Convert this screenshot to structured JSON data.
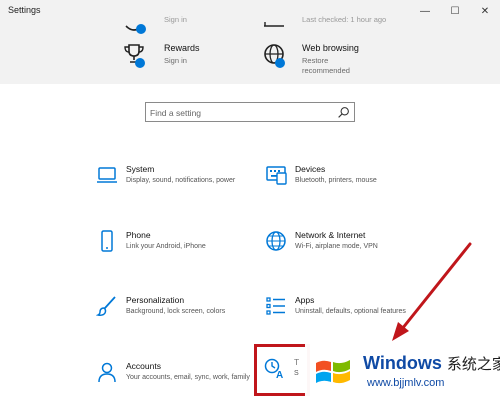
{
  "window": {
    "title": "Settings",
    "minimize": "—",
    "maximize": "☐",
    "close": "✕"
  },
  "banner": {
    "top_left_sub": "Sign in",
    "top_right_sub": "Last checked: 1 hour ago",
    "rewards": {
      "title": "Rewards",
      "sub": "Sign in"
    },
    "web_browsing": {
      "title": "Web browsing",
      "sub_line1": "Restore",
      "sub_line2": "recommended"
    }
  },
  "search": {
    "placeholder": "Find a setting"
  },
  "categories": [
    {
      "title": "System",
      "desc": "Display, sound, notifications, power",
      "icon": "laptop-icon"
    },
    {
      "title": "Devices",
      "desc": "Bluetooth, printers, mouse",
      "icon": "keyboard-icon"
    },
    {
      "title": "Phone",
      "desc": "Link your Android, iPhone",
      "icon": "phone-icon"
    },
    {
      "title": "Network & Internet",
      "desc": "Wi-Fi, airplane mode, VPN",
      "icon": "globe-icon"
    },
    {
      "title": "Personalization",
      "desc": "Background, lock screen, colors",
      "icon": "brush-icon"
    },
    {
      "title": "Apps",
      "desc": "Uninstall, defaults, optional features",
      "icon": "apps-list-icon"
    },
    {
      "title": "Accounts",
      "desc": "Your accounts, email, sync, work, family",
      "icon": "person-icon"
    },
    {
      "title": "T",
      "desc": "S",
      "icon": "time-language-icon"
    }
  ],
  "watermark": {
    "brand": "Windows",
    "brand_cn": "系统之家",
    "url": "www.bjjmlv.com"
  },
  "colors": {
    "accent": "#0078d7",
    "highlight": "#c0161b",
    "banner_bg": "#f2f2f2"
  }
}
